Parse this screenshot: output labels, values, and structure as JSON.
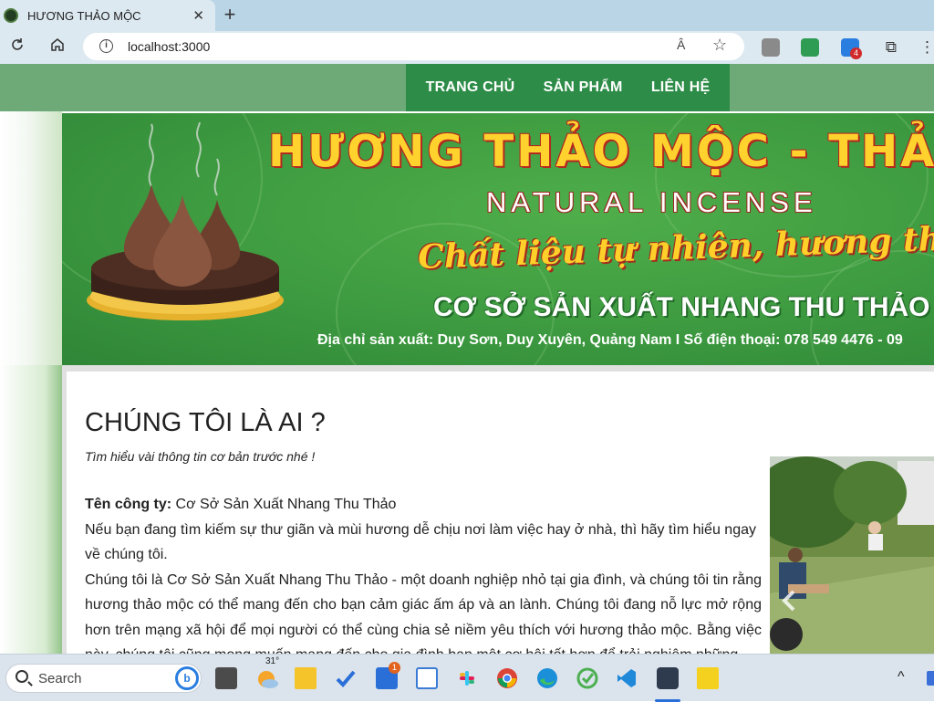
{
  "browser": {
    "tab_title": "HƯƠNG THẢO MỘC",
    "url": "localhost:3000",
    "read_aloud_label": "Â"
  },
  "nav": {
    "items": [
      "TRANG CHỦ",
      "SẢN PHẨM",
      "LIÊN HỆ"
    ]
  },
  "banner": {
    "title": "HƯƠNG THẢO MỘC - THẢO M",
    "subtitle": "NATURAL INCENSE",
    "slogan": "Chất liệu tự nhiên, hương thơm cuộc sống",
    "facility": "CƠ SỞ SẢN XUẤT NHANG THU THẢO",
    "address": "Địa chỉ sản xuất: Duy Sơn, Duy Xuyên, Quảng Nam I Số điện thoại: 078 549 4476 - 09"
  },
  "about": {
    "heading": "CHÚNG TÔI LÀ AI ?",
    "tagline": "Tìm hiểu vài thông tin cơ bản trước nhé !",
    "company_label": "Tên công ty:",
    "company_name": " Cơ Sở Sản Xuất Nhang Thu Thảo",
    "para1": "Nếu bạn đang tìm kiếm sự thư giãn và mùi hương dễ chịu nơi làm việc hay ở nhà, thì hãy tìm hiểu ngay về chúng tôi.",
    "para2": "Chúng tôi là Cơ Sở Sản Xuất Nhang Thu Thảo - một doanh nghiệp nhỏ tại gia đình, và chúng tôi tin rằng hương thảo mộc có thể mang đến cho bạn cảm giác ấm áp và an lành. Chúng tôi đang nỗ lực mở rộng hơn trên mạng xã hội để mọi người có thể cùng chia sẻ niềm yêu thích với hương thảo mộc. Bằng việc này, chúng tôi cũng mong muốn mang đến cho gia đình bạn một cơ hội tốt hơn để trải nghiệm những"
  },
  "taskbar": {
    "search_placeholder": "Search",
    "weather_temp": "31°",
    "todo_badge": "1",
    "ext_badge": "4"
  }
}
